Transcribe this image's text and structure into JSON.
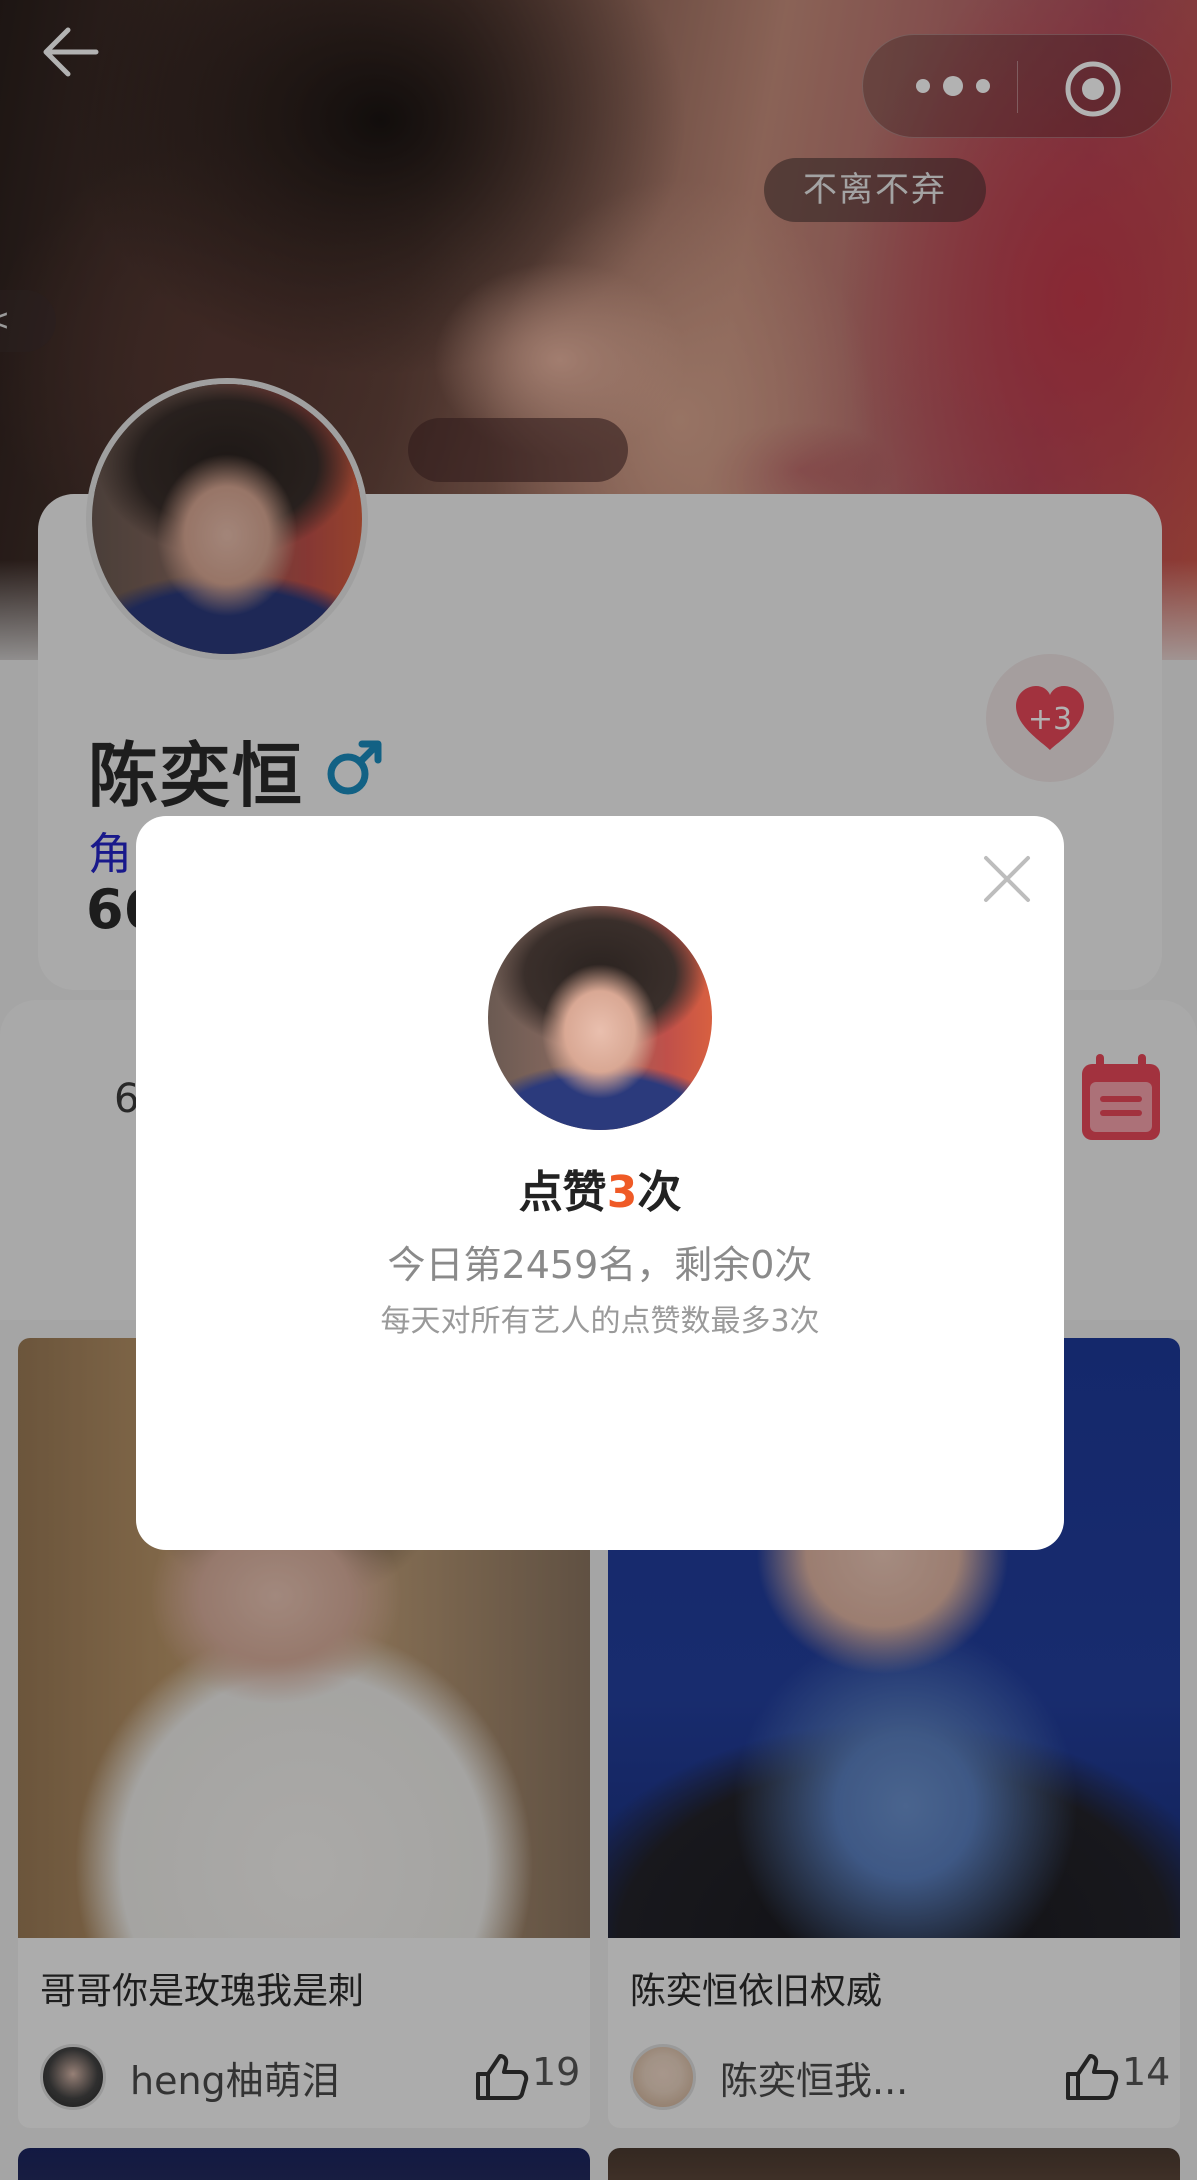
{
  "hero": {
    "tag": "不离不弃",
    "left_pill": "<"
  },
  "profile": {
    "name": "陈奕恒",
    "gender_icon": "male-icon",
    "role_label": "角",
    "number_label": "66",
    "like_badge": "+3"
  },
  "stats": {
    "value_partial": "6"
  },
  "posts": [
    {
      "title": "哥哥你是玫瑰我是刺",
      "author": "heng柚萌泪",
      "likes": "19"
    },
    {
      "title": "陈奕恒依旧权威",
      "author": "陈奕恒我...",
      "likes": "14"
    }
  ],
  "modal": {
    "title_prefix": "点赞",
    "title_count": "3",
    "title_suffix": "次",
    "rank_line": "今日第2459名，剩余0次",
    "hint": "每天对所有艺人的点赞数最多3次"
  },
  "colors": {
    "accent_orange": "#ef5a26",
    "heart_red": "#e8485a",
    "role_blue": "#2424c8",
    "male_blue": "#1a8bbd"
  }
}
